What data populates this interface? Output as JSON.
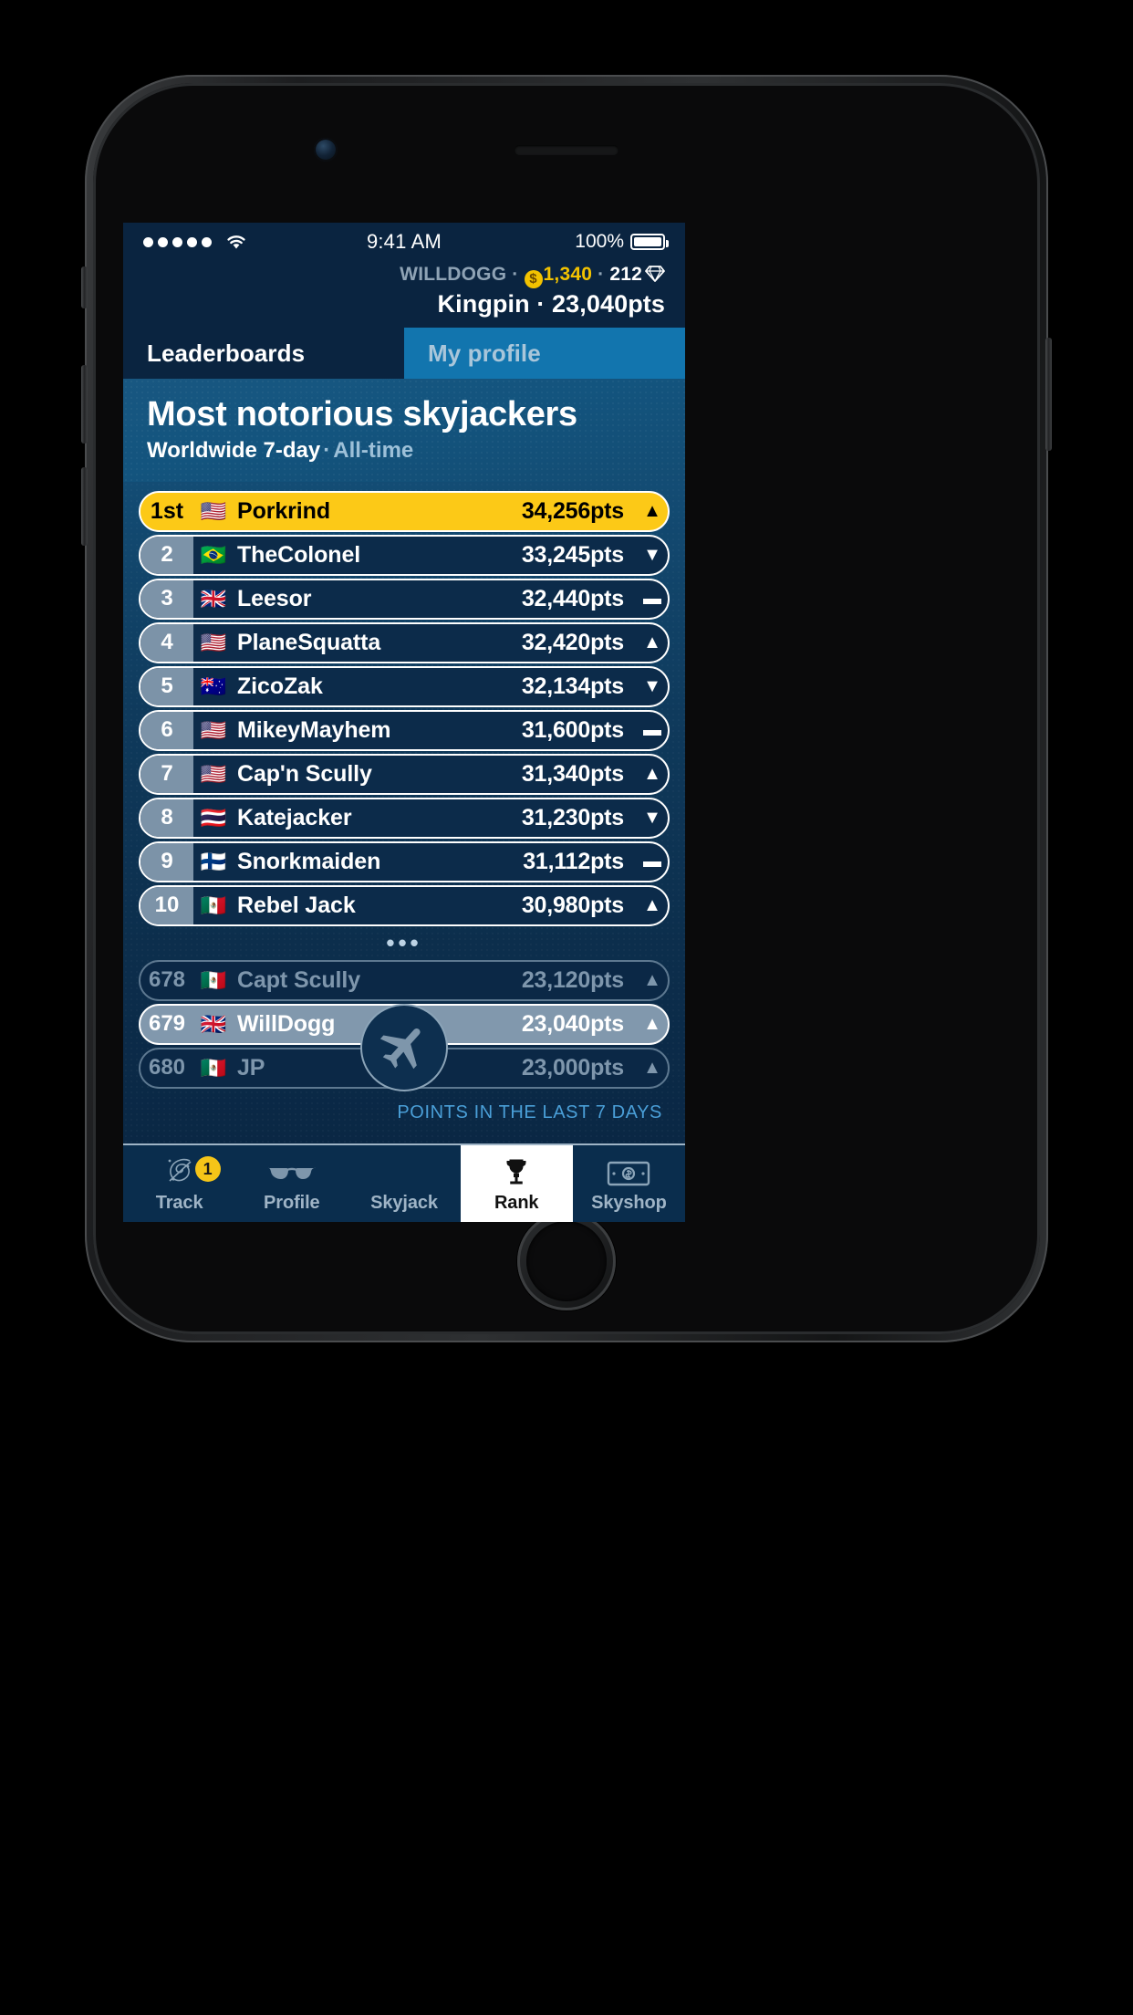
{
  "status_bar": {
    "signal_dots": 5,
    "wifi_icon": "wifi-icon",
    "time": "9:41 AM",
    "battery_percent": "100%"
  },
  "user_bar": {
    "username": "WILLDOGG",
    "coins": "1,340",
    "gems": "212",
    "rank_title": "Kingpin",
    "points": "23,040pts",
    "separator": "·"
  },
  "top_tabs": [
    {
      "label": "Leaderboards",
      "active": true
    },
    {
      "label": "My profile",
      "active": false
    }
  ],
  "header": {
    "title": "Most notorious skyjackers",
    "scope": "Worldwide 7-day",
    "separator": "·",
    "alt_scope": "All-time"
  },
  "leaderboard": {
    "top_rows": [
      {
        "rank": "1st",
        "flag": "🇺🇸",
        "name": "Porkrind",
        "points": "34,256pts",
        "trend": "▲",
        "style": "gold"
      },
      {
        "rank": "2",
        "flag": "🇧🇷",
        "name": "TheColonel",
        "points": "33,245pts",
        "trend": "▼",
        "style": "normal"
      },
      {
        "rank": "3",
        "flag": "🇬🇧",
        "name": "Leesor",
        "points": "32,440pts",
        "trend": "▬",
        "style": "normal"
      },
      {
        "rank": "4",
        "flag": "🇺🇸",
        "name": "PlaneSquatta",
        "points": "32,420pts",
        "trend": "▲",
        "style": "normal"
      },
      {
        "rank": "5",
        "flag": "🇦🇺",
        "name": "ZicoZak",
        "points": "32,134pts",
        "trend": "▼",
        "style": "normal"
      },
      {
        "rank": "6",
        "flag": "🇺🇸",
        "name": "MikeyMayhem",
        "points": "31,600pts",
        "trend": "▬",
        "style": "normal"
      },
      {
        "rank": "7",
        "flag": "🇺🇸",
        "name": "Cap'n Scully",
        "points": "31,340pts",
        "trend": "▲",
        "style": "normal"
      },
      {
        "rank": "8",
        "flag": "🇹🇭",
        "name": "Katejacker",
        "points": "31,230pts",
        "trend": "▼",
        "style": "normal"
      },
      {
        "rank": "9",
        "flag": "🇫🇮",
        "name": "Snorkmaiden",
        "points": "31,112pts",
        "trend": "▬",
        "style": "normal"
      },
      {
        "rank": "10",
        "flag": "🇲🇽",
        "name": "Rebel Jack",
        "points": "30,980pts",
        "trend": "▲",
        "style": "normal"
      }
    ],
    "ellipsis": "•••",
    "near_rows": [
      {
        "rank": "678",
        "flag": "🇲🇽",
        "name": "Capt Scully",
        "points": "23,120pts",
        "trend": "▲",
        "style": "dim"
      },
      {
        "rank": "679",
        "flag": "🇬🇧",
        "name": "WillDogg",
        "points": "23,040pts",
        "trend": "▲",
        "style": "me"
      },
      {
        "rank": "680",
        "flag": "🇲🇽",
        "name": "JP",
        "points": "23,000pts",
        "trend": "▲",
        "style": "dim"
      }
    ],
    "footnote": "POINTS IN THE LAST 7 DAYS"
  },
  "bottom_nav": [
    {
      "label": "Track",
      "icon": "radar-icon",
      "active": false,
      "badge": "1"
    },
    {
      "label": "Profile",
      "icon": "sunglasses-icon",
      "active": false,
      "badge": ""
    },
    {
      "label": "Skyjack",
      "icon": "airplane-icon",
      "active": false,
      "badge": ""
    },
    {
      "label": "Rank",
      "icon": "trophy-icon",
      "active": true,
      "badge": ""
    },
    {
      "label": "Skyshop",
      "icon": "banknote-icon",
      "active": false,
      "badge": ""
    }
  ],
  "colors": {
    "gold": "#fcc917",
    "navy": "#0a2440",
    "accent_blue": "#1275ae",
    "link_blue": "#4a9fd8"
  }
}
